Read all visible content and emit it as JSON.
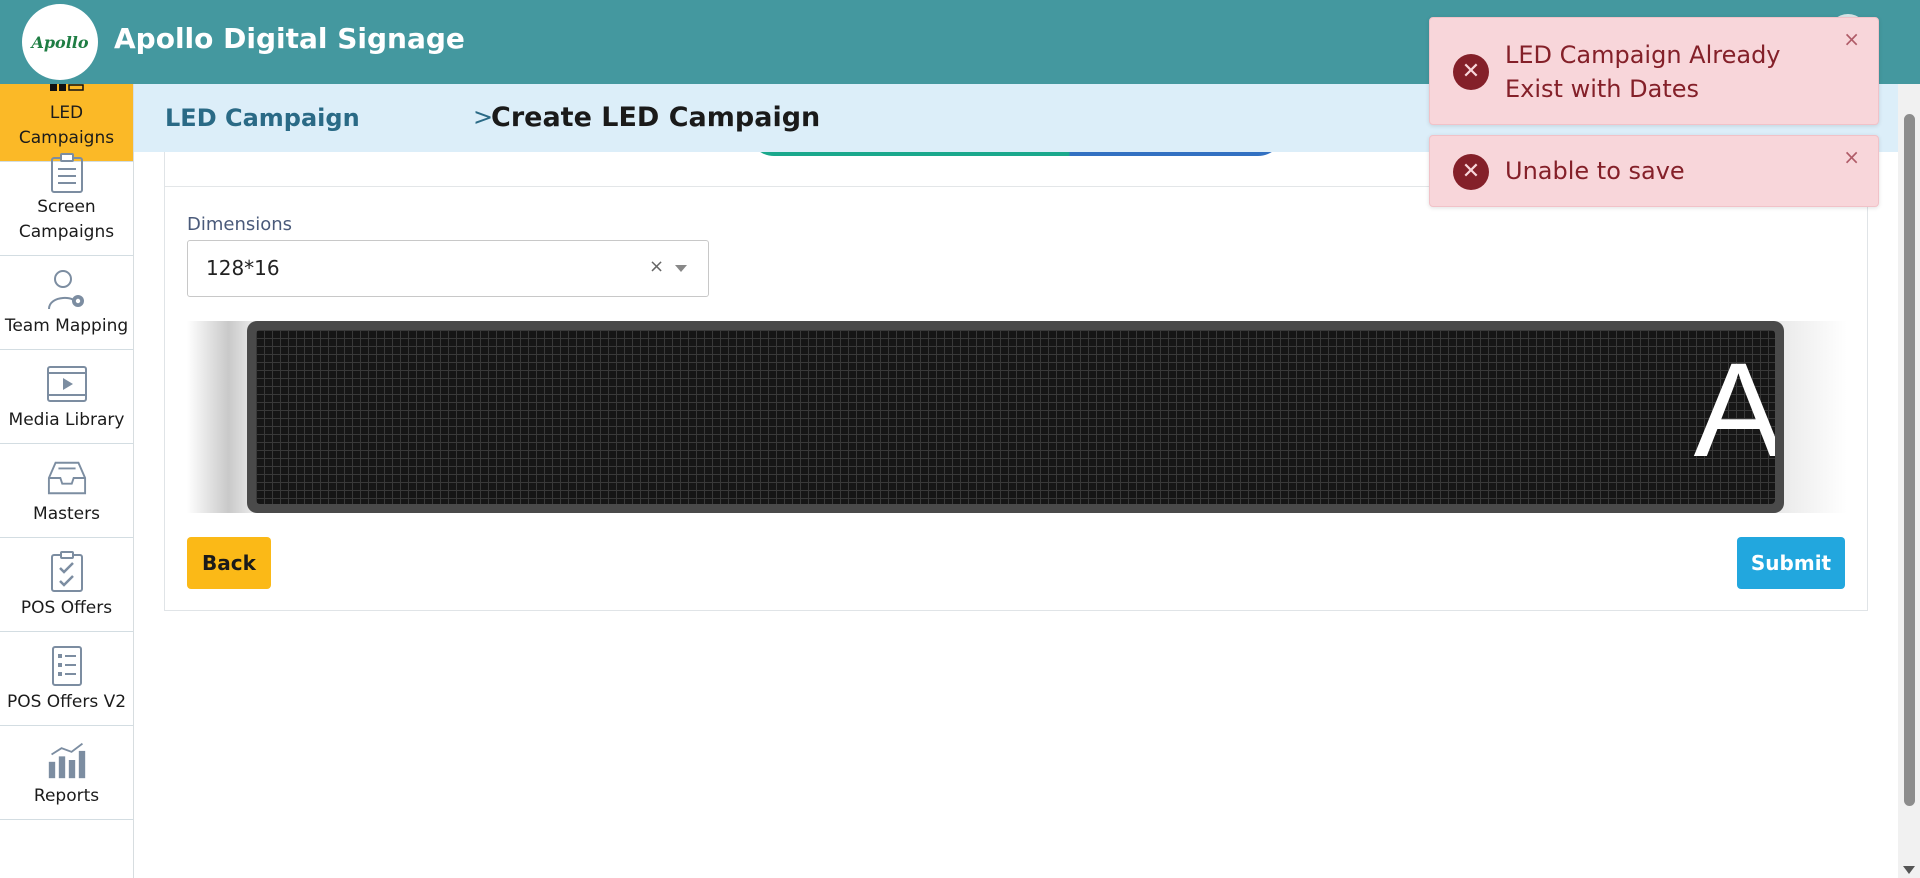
{
  "app": {
    "title": "Apollo Digital Signage",
    "logo_text": "Apollo",
    "brand_color": "#44989f"
  },
  "sidebar": {
    "items": [
      {
        "label": "LED Campaigns",
        "icon": "led-grid-icon",
        "active": true
      },
      {
        "label": "Screen Campaigns",
        "icon": "clipboard-list-icon",
        "active": false
      },
      {
        "label": "Team Mapping",
        "icon": "user-gear-icon",
        "active": false
      },
      {
        "label": "Media Library",
        "icon": "video-icon",
        "active": false
      },
      {
        "label": "Masters",
        "icon": "inbox-icon",
        "active": false
      },
      {
        "label": "POS Offers",
        "icon": "checklist-icon",
        "active": false
      },
      {
        "label": "POS Offers V2",
        "icon": "list-doc-icon",
        "active": false
      },
      {
        "label": "Reports",
        "icon": "bar-chart-icon",
        "active": false
      }
    ],
    "active_color": "#fbb927"
  },
  "breadcrumb": {
    "parent": "LED Campaign",
    "separator": ">",
    "current": "Create LED Campaign"
  },
  "form": {
    "dimensions_label": "Dimensions",
    "dimensions_value": "128*16",
    "clear_symbol": "×"
  },
  "preview": {
    "text": "A"
  },
  "actions": {
    "back_label": "Back",
    "submit_label": "Submit"
  },
  "toasts": [
    {
      "message": "LED Campaign Already Exist with Dates",
      "icon": "error-x-icon",
      "close": "×"
    },
    {
      "message": "Unable to save",
      "icon": "error-x-icon",
      "close": "×"
    }
  ]
}
